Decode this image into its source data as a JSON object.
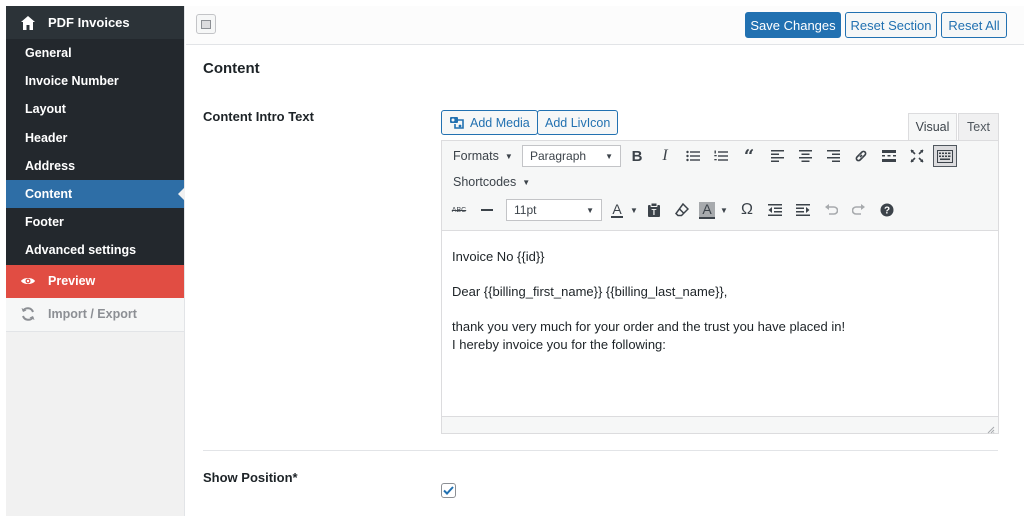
{
  "sidebar": {
    "header": {
      "label": "PDF Invoices",
      "icon": "home-icon"
    },
    "items": [
      {
        "label": "General"
      },
      {
        "label": "Invoice Number"
      },
      {
        "label": "Layout"
      },
      {
        "label": "Header"
      },
      {
        "label": "Address"
      },
      {
        "label": "Content",
        "active": true
      },
      {
        "label": "Footer"
      },
      {
        "label": "Advanced settings"
      }
    ],
    "preview": {
      "label": "Preview",
      "icon": "eye-icon"
    },
    "import_export": {
      "label": "Import / Export",
      "icon": "refresh-icon"
    }
  },
  "topbar": {
    "save_label": "Save Changes",
    "reset_section_label": "Reset Section",
    "reset_all_label": "Reset All"
  },
  "main": {
    "section_title": "Content",
    "content_intro_label": "Content Intro Text",
    "add_media_label": "Add Media",
    "add_livicon_label": "Add LivIcon",
    "tabs": {
      "visual": "Visual",
      "text": "Text",
      "active": "visual"
    },
    "toolbar": {
      "formats_label": "Formats",
      "paragraph_value": "Paragraph",
      "shortcodes_label": "Shortcodes",
      "fontsize_value": "11pt",
      "strikethrough_label": "ABC",
      "text_color_letter": "A",
      "row1_icons": [
        "bold-icon",
        "italic-icon",
        "bullet-list-icon",
        "numbered-list-icon",
        "blockquote-icon",
        "align-left-icon",
        "align-center-icon",
        "align-right-icon",
        "link-icon",
        "read-more-icon",
        "fullscreen-icon",
        "toolbar-toggle-icon"
      ],
      "row3_icons": [
        "strikethrough-icon",
        "horizontal-line-icon",
        "text-color-icon",
        "paste-text-icon",
        "clear-formatting-icon",
        "background-color-icon",
        "special-character-icon",
        "outdent-icon",
        "indent-icon",
        "undo-icon",
        "redo-icon",
        "help-icon"
      ]
    },
    "editor_lines": {
      "line1": "Invoice No {{id}}",
      "line2": "Dear {{billing_first_name}} {{billing_last_name}},",
      "line3": "thank you very much for your order and the trust you have placed in!",
      "line4": "I hereby invoice you for the following:"
    },
    "show_position_label": "Show Position*",
    "show_position_checked": true
  },
  "colors": {
    "sidebar_bg": "#23282d",
    "active_item": "#2e6ea6",
    "preview_bg": "#e14d43",
    "primary_button": "#2271b1"
  }
}
